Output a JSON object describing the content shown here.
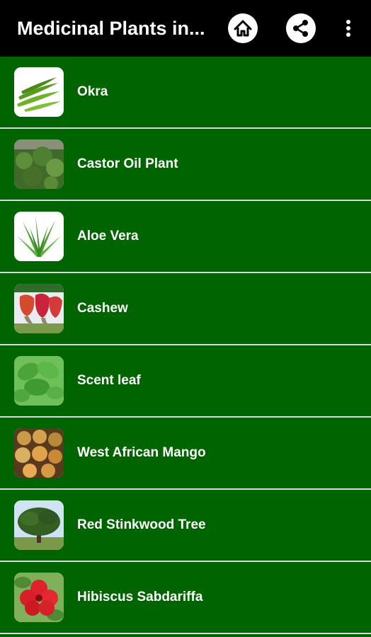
{
  "app": {
    "title": "Medicinal Plants in..."
  },
  "toolbar": {
    "icons": [
      "home-icon",
      "share-icon",
      "more-vert-icon"
    ]
  },
  "colors": {
    "toolbar_bg": "#000000",
    "list_bg": "#006400",
    "divider": "#d9d9d9",
    "text": "#ffffff"
  },
  "plants": [
    {
      "name": "Okra",
      "icon": "okra-thumbnail"
    },
    {
      "name": "Castor Oil Plant",
      "icon": "castor-oil-plant-thumbnail"
    },
    {
      "name": "Aloe Vera",
      "icon": "aloe-vera-thumbnail"
    },
    {
      "name": "Cashew",
      "icon": "cashew-thumbnail"
    },
    {
      "name": "Scent leaf",
      "icon": "scent-leaf-thumbnail"
    },
    {
      "name": "West African Mango",
      "icon": "west-african-mango-thumbnail"
    },
    {
      "name": "Red Stinkwood Tree",
      "icon": "red-stinkwood-tree-thumbnail"
    },
    {
      "name": "Hibiscus Sabdariffa",
      "icon": "hibiscus-sabdariffa-thumbnail"
    }
  ]
}
